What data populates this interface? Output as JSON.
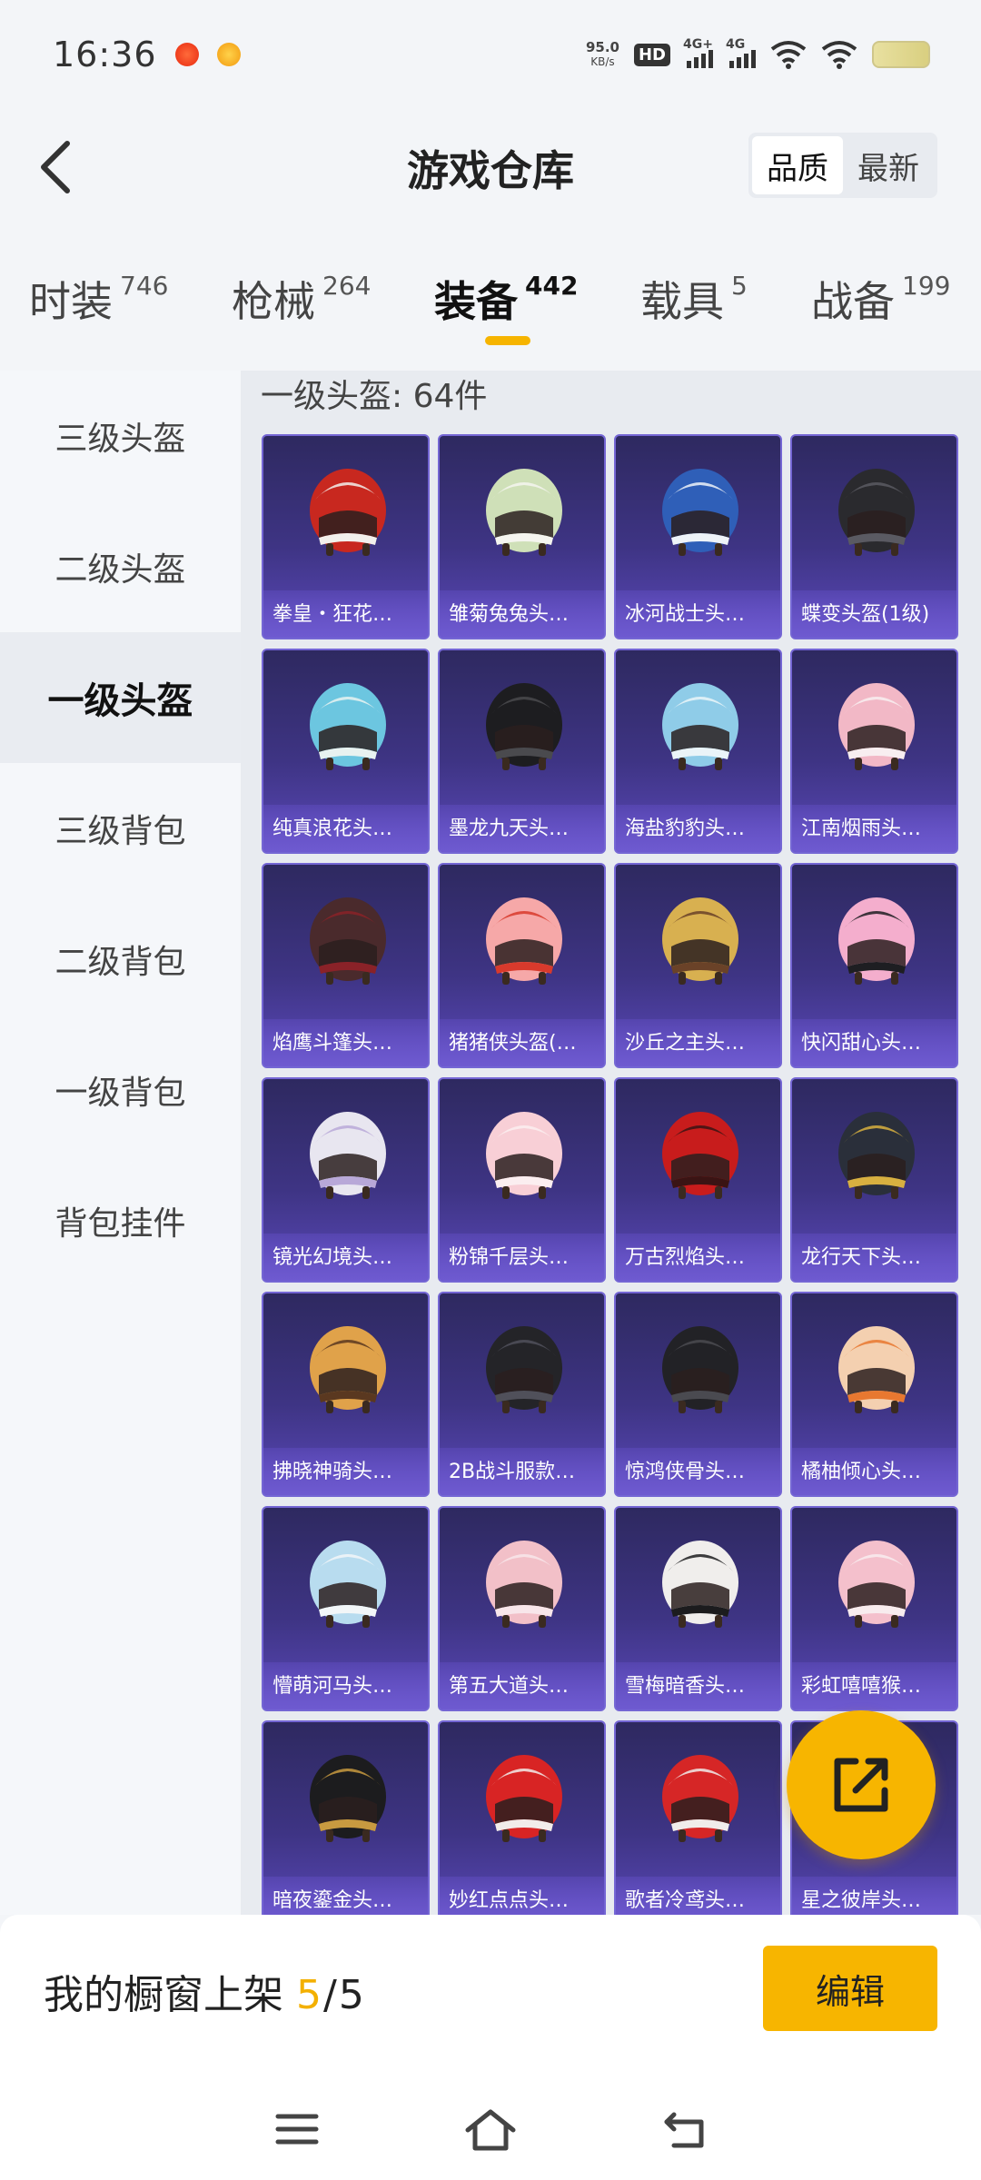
{
  "status": {
    "time": "16:36",
    "net_speed_value": "95.0",
    "net_speed_unit": "KB/s",
    "hd_label": "HD",
    "signal1_label": "4G+",
    "signal2_label": "4G"
  },
  "header": {
    "title": "游戏仓库",
    "sort_options": [
      "品质",
      "最新"
    ],
    "sort_active": "品质"
  },
  "category_tabs": [
    {
      "name": "时装",
      "count": "746"
    },
    {
      "name": "枪械",
      "count": "264"
    },
    {
      "name": "装备",
      "count": "442",
      "active": true
    },
    {
      "name": "载具",
      "count": "5"
    },
    {
      "name": "战备",
      "count": "199"
    }
  ],
  "side_nav": [
    "三级头盔",
    "二级头盔",
    "一级头盔",
    "三级背包",
    "二级背包",
    "一级背包",
    "背包挂件"
  ],
  "side_nav_active": "一级头盔",
  "content": {
    "section_title": "一级头盔: 64件"
  },
  "items": [
    {
      "label": "拳皇・狂花…",
      "icon": "helmet-icon",
      "colors": [
        "#c8281f",
        "#f2f0ec"
      ]
    },
    {
      "label": "雏菊兔兔头…",
      "icon": "helmet-icon",
      "colors": [
        "#cfe0b8",
        "#f5f5ef"
      ]
    },
    {
      "label": "冰河战士头…",
      "icon": "helmet-icon",
      "colors": [
        "#2f5fb8",
        "#eef3f8"
      ]
    },
    {
      "label": "蝶变头盔(1级)",
      "icon": "helmet-icon",
      "colors": [
        "#2a2a2e",
        "#5a5a62"
      ]
    },
    {
      "label": "纯真浪花头…",
      "icon": "helmet-icon",
      "colors": [
        "#6cc6e0",
        "#e8f2f0"
      ]
    },
    {
      "label": "墨龙九天头…",
      "icon": "helmet-icon",
      "colors": [
        "#1d1d20",
        "#4a4a4e"
      ]
    },
    {
      "label": "海盐豹豹头…",
      "icon": "helmet-icon",
      "colors": [
        "#8fcce8",
        "#eaf4f8"
      ]
    },
    {
      "label": "江南烟雨头…",
      "icon": "helmet-icon",
      "colors": [
        "#f2b8c6",
        "#f8eef0"
      ]
    },
    {
      "label": "焰鹰斗篷头…",
      "icon": "helmet-icon",
      "colors": [
        "#4a2a2c",
        "#8a2228"
      ]
    },
    {
      "label": "猪猪侠头盔(…",
      "icon": "helmet-icon",
      "colors": [
        "#f6a8a8",
        "#d83a2c"
      ]
    },
    {
      "label": "沙丘之主头…",
      "icon": "helmet-icon",
      "colors": [
        "#d8b050",
        "#6a4228"
      ]
    },
    {
      "label": "快闪甜心头…",
      "icon": "helmet-icon",
      "colors": [
        "#f4aecd",
        "#1e1e22"
      ]
    },
    {
      "label": "镜光幻境头…",
      "icon": "helmet-icon",
      "colors": [
        "#e8e6f0",
        "#b8a8d8"
      ]
    },
    {
      "label": "粉锦千层头…",
      "icon": "helmet-icon",
      "colors": [
        "#f8cfd6",
        "#fbeef0"
      ]
    },
    {
      "label": "万古烈焰头…",
      "icon": "helmet-icon",
      "colors": [
        "#c81c1c",
        "#3a1414"
      ]
    },
    {
      "label": "龙行天下头…",
      "icon": "helmet-icon",
      "colors": [
        "#2a2f3a",
        "#d8b040"
      ]
    },
    {
      "label": "拂晓神骑头…",
      "icon": "helmet-icon",
      "colors": [
        "#e0a24a",
        "#5a3820"
      ]
    },
    {
      "label": "2B战斗服款…",
      "icon": "helmet-icon",
      "colors": [
        "#242428",
        "#50505a"
      ]
    },
    {
      "label": "惊鸿侠骨头…",
      "icon": "helmet-icon",
      "colors": [
        "#222226",
        "#4a4a50"
      ]
    },
    {
      "label": "橘柚倾心头…",
      "icon": "helmet-icon",
      "colors": [
        "#f4d0b0",
        "#e87830"
      ]
    },
    {
      "label": "懵萌河马头…",
      "icon": "helmet-icon",
      "colors": [
        "#b8dcef",
        "#f2f6f8"
      ]
    },
    {
      "label": "第五大道头…",
      "icon": "helmet-icon",
      "colors": [
        "#f2c0c8",
        "#f8e6ea"
      ]
    },
    {
      "label": "雪梅暗香头…",
      "icon": "helmet-icon",
      "colors": [
        "#f0eeec",
        "#1c1c1e"
      ]
    },
    {
      "label": "彩虹嘻嘻猴…",
      "icon": "helmet-icon",
      "colors": [
        "#f4c0cc",
        "#f8ecee"
      ]
    },
    {
      "label": "暗夜鎏金头…",
      "icon": "helmet-icon",
      "colors": [
        "#1c1c1e",
        "#c89a40"
      ]
    },
    {
      "label": "妙红点点头…",
      "icon": "helmet-icon",
      "colors": [
        "#d82424",
        "#f2ecea"
      ]
    },
    {
      "label": "歌者冷鸢头…",
      "icon": "helmet-icon",
      "colors": [
        "#d62626",
        "#f0ecea"
      ]
    },
    {
      "label": "星之彼岸头…",
      "icon": "helmet-icon",
      "colors": [
        "#f4f0ec",
        "#e05050"
      ]
    }
  ],
  "share_button": {
    "icon": "share-icon"
  },
  "bottom_bar": {
    "shelf_label": "我的橱窗上架",
    "shelf_count": "5",
    "shelf_separator": "/",
    "shelf_total": "5",
    "edit_label": "编辑"
  },
  "nav_bar": {
    "icons": [
      "menu-icon",
      "home-icon",
      "back-nav-icon"
    ]
  },
  "colors": {
    "accent": "#f7b500",
    "card_top": "#2e2960",
    "card_bottom": "#5a48b8"
  }
}
